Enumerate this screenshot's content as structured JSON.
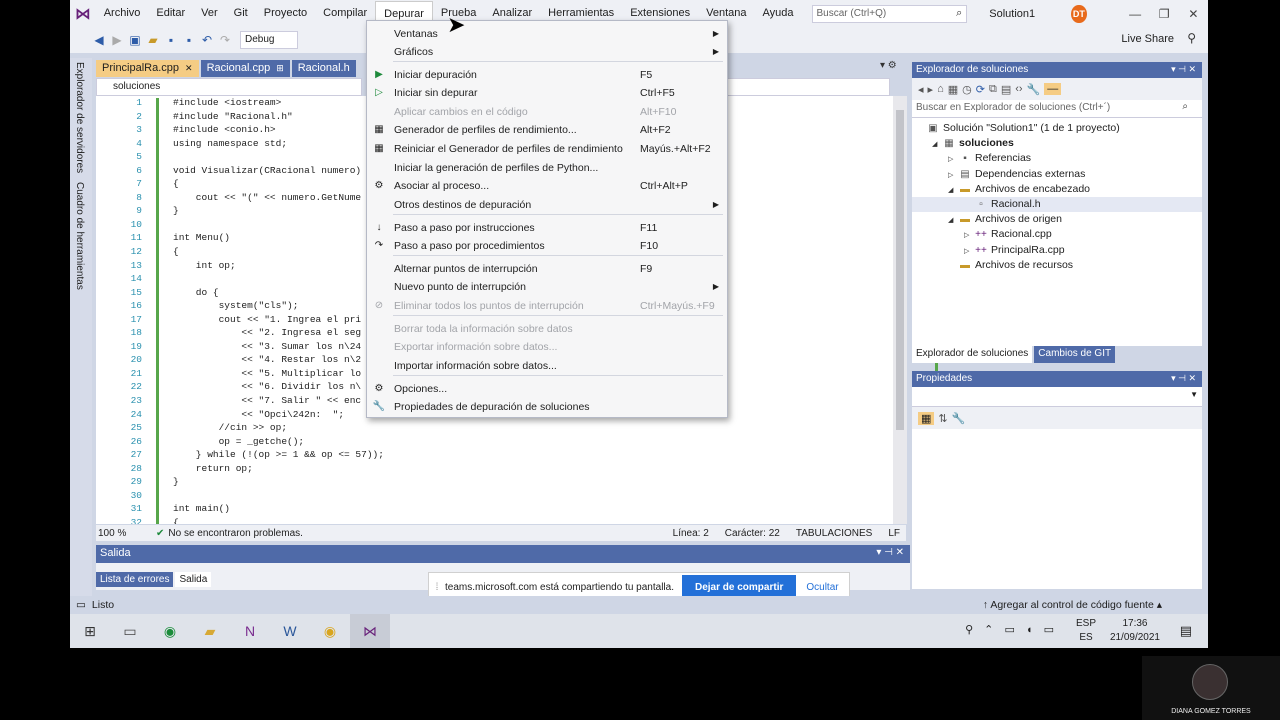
{
  "menubar": {
    "items": [
      "Archivo",
      "Editar",
      "Ver",
      "Git",
      "Proyecto",
      "Compilar",
      "Depurar",
      "Prueba",
      "Analizar",
      "Herramientas",
      "Extensiones",
      "Ventana",
      "Ayuda"
    ],
    "search_placeholder": "Buscar (Ctrl+Q)",
    "solution_title": "Solution1",
    "avatar_initials": "DT",
    "live_share": "Live Share"
  },
  "toolbar": {
    "config": "Debug"
  },
  "rail": {
    "item1": "Explorador de servidores",
    "item2": "Cuadro de herramientas"
  },
  "editor": {
    "tabs": [
      "PrincipalRa.cpp",
      "Racional.cpp",
      "Racional.h"
    ],
    "nav_scope": "soluciones",
    "line_numbers": [
      "1",
      "2",
      "3",
      "4",
      "5",
      "6",
      "7",
      "8",
      "9",
      "10",
      "11",
      "12",
      "13",
      "14",
      "15",
      "16",
      "17",
      "18",
      "19",
      "20",
      "21",
      "22",
      "23",
      "24",
      "25",
      "26",
      "27",
      "28",
      "29",
      "30",
      "31",
      "32"
    ],
    "lines": [
      "#include <iostream>",
      "#include \"Racional.h\"",
      "#include <conio.h>",
      "using namespace std;",
      "",
      "void Visualizar(CRacional numero)",
      "{",
      "    cout << \"(\" << numero.GetNume",
      "}",
      "",
      "int Menu()",
      "{",
      "    int op;",
      "",
      "    do {",
      "        system(\"cls\");",
      "        cout << \"1. Ingrea el pri",
      "            << \"2. Ingresa el seg",
      "            << \"3. Sumar los n\\24",
      "            << \"4. Restar los n\\2",
      "            << \"5. Multiplicar lo",
      "            << \"6. Dividir los n\\",
      "            << \"7. Salir \" << enc",
      "            << \"Opci\\242n:  \";",
      "        //cin >> op;",
      "        op = _getche();",
      "    } while (!(op >= 1 && op <= 57));",
      "    return op;",
      "}",
      "",
      "int main()",
      "{"
    ],
    "zoom": "100 %",
    "problems": "No se encontraron problemas.",
    "line": "Línea: 2",
    "char": "Carácter: 22",
    "tabs_mode": "TABULACIONES",
    "eol": "LF"
  },
  "output": {
    "title": "Salida",
    "tabs": [
      "Lista de errores",
      "Salida"
    ]
  },
  "depurar_menu": [
    {
      "label": "Ventanas",
      "shortcut": "",
      "icon": "",
      "submenu": true,
      "disabled": false
    },
    {
      "label": "Gráficos",
      "shortcut": "",
      "icon": "",
      "submenu": true,
      "disabled": false
    },
    {
      "label": "Iniciar depuración",
      "shortcut": "F5",
      "icon": "▶",
      "submenu": false,
      "disabled": false
    },
    {
      "label": "Iniciar sin depurar",
      "shortcut": "Ctrl+F5",
      "icon": "▷",
      "submenu": false,
      "disabled": false
    },
    {
      "label": "Aplicar cambios en el código",
      "shortcut": "Alt+F10",
      "icon": "",
      "submenu": false,
      "disabled": true
    },
    {
      "label": "Generador de perfiles de rendimiento...",
      "shortcut": "Alt+F2",
      "icon": "▦",
      "submenu": false,
      "disabled": false
    },
    {
      "label": "Reiniciar el Generador de perfiles de rendimiento",
      "shortcut": "Mayús.+Alt+F2",
      "icon": "▦",
      "submenu": false,
      "disabled": false
    },
    {
      "label": "Iniciar la generación de perfiles de Python...",
      "shortcut": "",
      "icon": "",
      "submenu": false,
      "disabled": false
    },
    {
      "label": "Asociar al proceso...",
      "shortcut": "Ctrl+Alt+P",
      "icon": "⚙",
      "submenu": false,
      "disabled": false
    },
    {
      "label": "Otros destinos de depuración",
      "shortcut": "",
      "icon": "",
      "submenu": true,
      "disabled": false
    },
    {
      "label": "Paso a paso por instrucciones",
      "shortcut": "F11",
      "icon": "↓",
      "submenu": false,
      "disabled": false
    },
    {
      "label": "Paso a paso por procedimientos",
      "shortcut": "F10",
      "icon": "↷",
      "submenu": false,
      "disabled": false
    },
    {
      "label": "Alternar puntos de interrupción",
      "shortcut": "F9",
      "icon": "",
      "submenu": false,
      "disabled": false
    },
    {
      "label": "Nuevo punto de interrupción",
      "shortcut": "",
      "icon": "",
      "submenu": true,
      "disabled": false
    },
    {
      "label": "Eliminar todos los puntos de interrupción",
      "shortcut": "Ctrl+Mayús.+F9",
      "icon": "⊘",
      "submenu": false,
      "disabled": true
    },
    {
      "label": "Borrar toda la información sobre datos",
      "shortcut": "",
      "icon": "",
      "submenu": false,
      "disabled": true
    },
    {
      "label": "Exportar información sobre datos...",
      "shortcut": "",
      "icon": "",
      "submenu": false,
      "disabled": true
    },
    {
      "label": "Importar información sobre datos...",
      "shortcut": "",
      "icon": "",
      "submenu": false,
      "disabled": false
    },
    {
      "label": "Opciones...",
      "shortcut": "",
      "icon": "⚙",
      "submenu": false,
      "disabled": false
    },
    {
      "label": "Propiedades de depuración de soluciones",
      "shortcut": "",
      "icon": "🔧",
      "submenu": false,
      "disabled": false
    }
  ],
  "solution_explorer": {
    "title": "Explorador de soluciones",
    "search_placeholder": "Buscar en Explorador de soluciones (Ctrl+´)",
    "items": [
      {
        "label": "Solución \"Solution1\" (1 de 1 proyecto)",
        "indent": 0,
        "arrow": "",
        "icon": "▣",
        "bold": false,
        "selected": false
      },
      {
        "label": "soluciones",
        "indent": 1,
        "arrow": "◢",
        "icon": "▦",
        "bold": true,
        "selected": false
      },
      {
        "label": "Referencias",
        "indent": 2,
        "arrow": "▷",
        "icon": "▪",
        "bold": false,
        "selected": false
      },
      {
        "label": "Dependencias externas",
        "indent": 2,
        "arrow": "▷",
        "icon": "▤",
        "bold": false,
        "selected": false
      },
      {
        "label": "Archivos de encabezado",
        "indent": 2,
        "arrow": "◢",
        "icon": "▬",
        "bold": false,
        "selected": false
      },
      {
        "label": "Racional.h",
        "indent": 3,
        "arrow": "",
        "icon": "▫",
        "bold": false,
        "selected": true
      },
      {
        "label": "Archivos de origen",
        "indent": 2,
        "arrow": "◢",
        "icon": "▬",
        "bold": false,
        "selected": false
      },
      {
        "label": "Racional.cpp",
        "indent": 3,
        "arrow": "▷",
        "icon": "++",
        "bold": false,
        "selected": false
      },
      {
        "label": "PrincipalRa.cpp",
        "indent": 3,
        "arrow": "▷",
        "icon": "++",
        "bold": false,
        "selected": false
      },
      {
        "label": "Archivos de recursos",
        "indent": 2,
        "arrow": "",
        "icon": "▬",
        "bold": false,
        "selected": false
      }
    ],
    "tabs": [
      "Explorador de soluciones",
      "Cambios de GIT"
    ]
  },
  "properties": {
    "title": "Propiedades"
  },
  "teams": {
    "message": "teams.microsoft.com está compartiendo tu pantalla.",
    "stop": "Dejar de compartir",
    "hide": "Ocultar"
  },
  "statusbar": {
    "ready": "Listo",
    "source_control": "Agregar al control de código fuente"
  },
  "taskbar": {
    "lang1": "ESP",
    "lang2": "ES",
    "time": "17:36",
    "date": "21/09/2021"
  },
  "webcam": {
    "name": "DIANA GOMEZ TORRES"
  }
}
